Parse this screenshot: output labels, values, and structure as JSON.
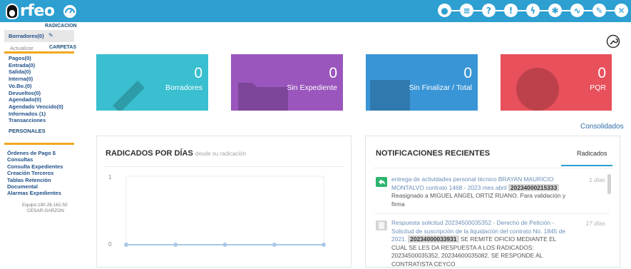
{
  "header": {
    "logo_text": "rfeo",
    "icons": [
      "dashboard-icon",
      "user-profile-icon",
      "list-icon",
      "help-icon",
      "info-icon",
      "flash-icon",
      "settings-icon",
      "activity-icon",
      "edit-icon",
      "close-icon"
    ],
    "color": "#2d9fd1"
  },
  "sidebar": {
    "radicacion_head": "RADICACION",
    "borradores": "Borradores(0)",
    "actualizar": "Actualizar",
    "carpetas_head": "CARPETAS",
    "carpetas": [
      "Pagos(0)",
      "Entrada(0)",
      "Salida(0)",
      "Interna(0)",
      "Vo.Bo.(0)",
      "Devueltos(0)",
      "Agendado(0)",
      "Agendado Vencido(0)",
      "Informados (1)",
      "Transacciones"
    ],
    "personales": "PERSONALES",
    "menu": [
      "Órdenes de Pago $",
      "Consultas",
      "Consulta Expedientes",
      "Creación Terceros",
      "Tablas Retención",
      "Documental",
      "Alarmas Expedientes"
    ],
    "equipo": "Equipo:190.26.162.50",
    "usuario": "CESAR.GARZON"
  },
  "cards": [
    {
      "value": "0",
      "label": "Borradores",
      "color": "#39bfd0"
    },
    {
      "value": "0",
      "label": "Sin Expediente",
      "color": "#9a56bd"
    },
    {
      "value": "0",
      "label": "Sin Finalizar / Total",
      "color": "#3a95d6"
    },
    {
      "value": "0",
      "label": "PQR",
      "color": "#e8505b"
    }
  ],
  "consolidados": "Consolidados",
  "radicados_panel": {
    "title": "RADICADOS POR DÍAS",
    "subtitle": "desde su radicación",
    "y_ticks": [
      "1",
      "0"
    ]
  },
  "chart_data": {
    "type": "line",
    "title": "RADICADOS POR DÍAS",
    "subtitle": "desde su radicación",
    "xlabel": "",
    "ylabel": "",
    "ylim": [
      0,
      1
    ],
    "y_ticks": [
      1,
      0
    ],
    "series": [
      {
        "values": [
          0,
          0,
          0,
          0,
          0
        ]
      }
    ],
    "color": "#a9c8e6"
  },
  "notifications": {
    "title": "NOTIFICACIONES RECIENTES",
    "tab": "Radicados",
    "items": [
      {
        "link_text": "entrega de actividades personal técnico BRAYAN MAURICIO MONTALVO contrato 1468 - 2023 mes abril",
        "badge": "20234000215333",
        "rest": "Reasignado a MIGUEL ANGEL ORTIZ RUANO. Para validación y firma",
        "days": "1 días",
        "icon": "reply-icon",
        "icon_color": "#2db56e"
      },
      {
        "link_text": "Respuesta solicitud 20234500035352 - Derecho de Petición - Solicitud de suscripción de la liquidación del contrato No. 1845 de 2021.",
        "badge": "20234000033931",
        "rest": "SE REMITE OFICIO MEDIANTE EL CUAL SE LES DA RESPUESTA A LOS RADICADOS: 20234500035352, 20234600035082. SE RESPONDE AL CONTRATISTA CEYCO",
        "days": "17 días",
        "icon": "document-icon",
        "icon_color": "#cccccc"
      }
    ]
  }
}
